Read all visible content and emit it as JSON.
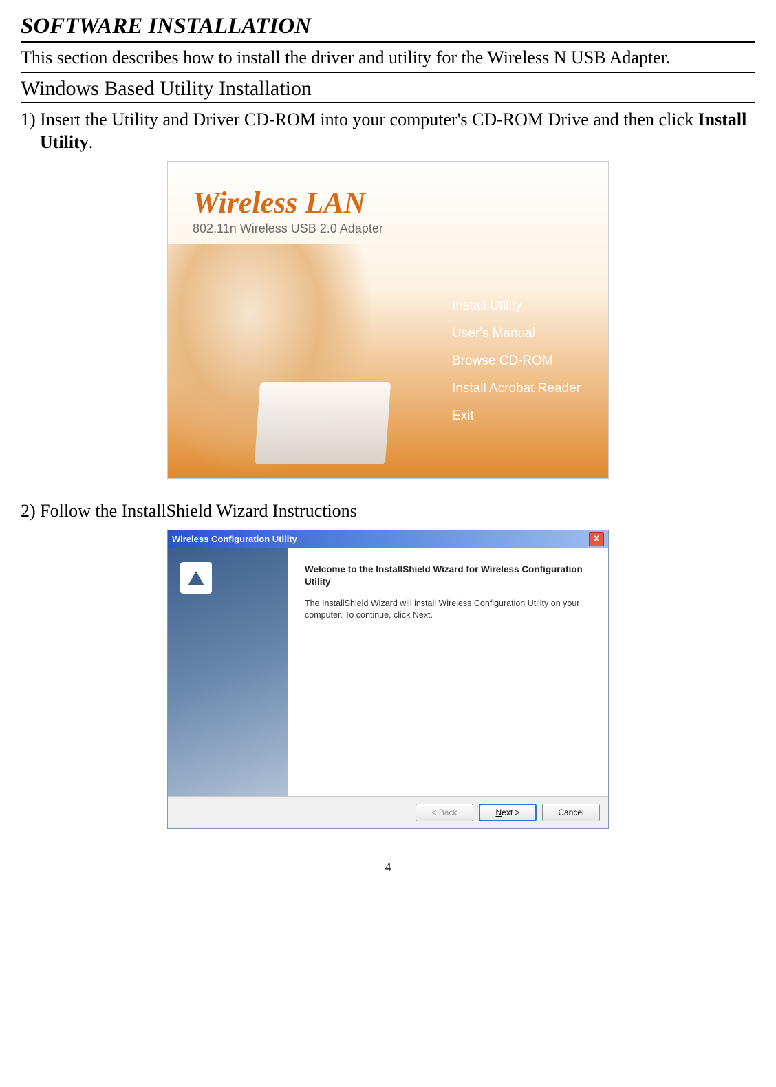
{
  "section_title": "SOFTWARE INSTALLATION",
  "intro": "This section describes how to install the driver and utility for the Wireless N USB Adapter.",
  "subsection": "Windows Based Utility Installation",
  "step1_prefix": "1) Insert the Utility and Driver CD-ROM into your computer's CD-ROM Drive and then click ",
  "step1_bold": "Install Utility",
  "step1_suffix": ".",
  "step2": "2) Follow the InstallShield Wizard Instructions",
  "cd": {
    "title": "Wireless LAN",
    "subtitle": "802.11n Wireless USB 2.0 Adapter",
    "menu": [
      "Install Utility",
      "User's Manual",
      "Browse CD-ROM",
      "Install Acrobat Reader",
      "Exit"
    ]
  },
  "wizard": {
    "titlebar": "Wireless Configuration Utility",
    "close_label": "X",
    "welcome": "Welcome to the InstallShield Wizard for Wireless Configuration Utility",
    "desc": "The InstallShield Wizard will install Wireless Configuration Utility on your computer.  To continue, click Next.",
    "back": "< Back",
    "next": "Next >",
    "cancel": "Cancel"
  },
  "page_number": "4"
}
